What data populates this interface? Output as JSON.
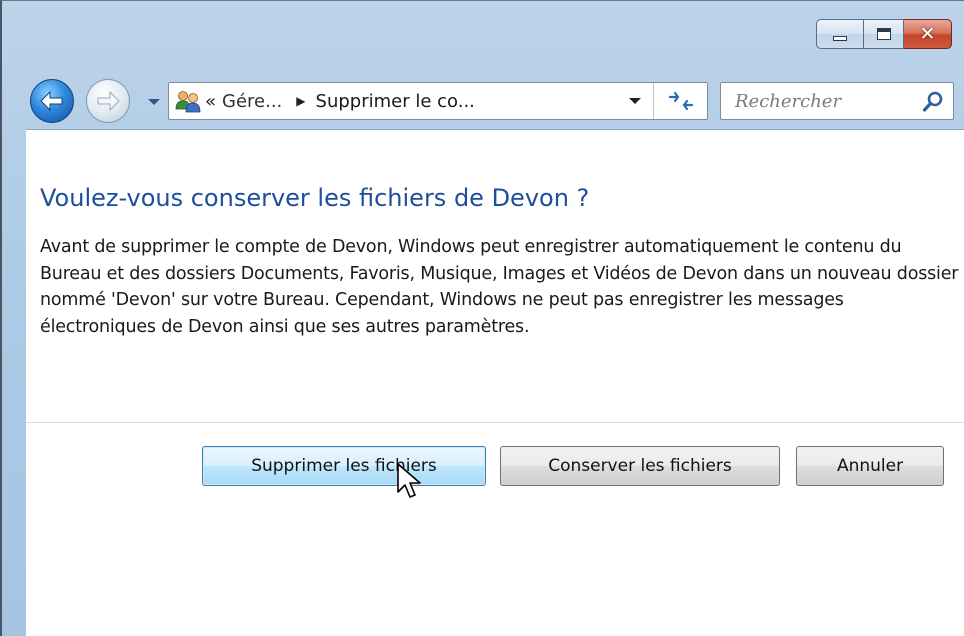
{
  "window": {
    "caption_buttons": {
      "minimize_icon": "minimize-icon",
      "maximize_icon": "maximize-icon",
      "close_glyph": "✕"
    }
  },
  "navigation": {
    "back_icon": "back-arrow-icon",
    "forward_icon": "forward-arrow-icon",
    "address": {
      "icon": "user-accounts-icon",
      "overflow_chevron": "«",
      "crumb_1": "Gére...",
      "separator": "▶",
      "crumb_2": "Supprimer le co..."
    },
    "search": {
      "placeholder": "Rechercher"
    }
  },
  "dialog": {
    "heading": "Voulez-vous conserver les fichiers de Devon ?",
    "body": "Avant de supprimer le compte de Devon, Windows peut enregistrer automatiquement le contenu du Bureau et des dossiers Documents, Favoris, Musique, Images et Vidéos de Devon dans un nouveau dossier nommé 'Devon' sur votre Bureau. Cependant, Windows ne peut pas enregistrer les messages électroniques de Devon ainsi que ses autres paramètres.",
    "buttons": {
      "delete_files": "Supprimer les fichiers",
      "keep_files": "Conserver les fichiers",
      "cancel": "Annuler"
    }
  },
  "colors": {
    "heading": "#1e4e9b",
    "frame": "#aecbe6",
    "primary_button_border": "#3c7fb1",
    "close_button": "#c4442c"
  }
}
